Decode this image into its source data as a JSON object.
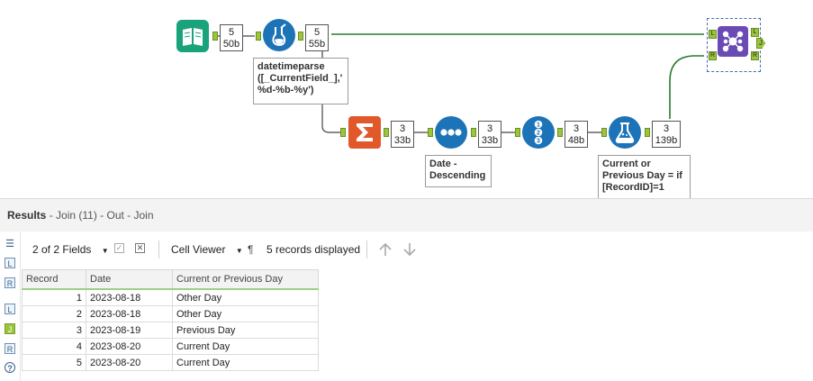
{
  "workflow": {
    "counts": [
      {
        "records": "5",
        "size": "50b"
      },
      {
        "records": "5",
        "size": "55b"
      },
      {
        "records": "3",
        "size": "33b"
      },
      {
        "records": "3",
        "size": "33b"
      },
      {
        "records": "3",
        "size": "48b"
      },
      {
        "records": "3",
        "size": "139b"
      }
    ],
    "annotations": {
      "formula": "datetimeparse\n([_CurrentField_],'\n%d-%b-%y')",
      "sort": "Date -\nDescending",
      "formula2": "Current or\nPrevious Day = if\n[RecordID]=1"
    },
    "join_anchors": {
      "left": "L",
      "right": "R",
      "join": "J",
      "out_left": "L",
      "out_right": "R"
    },
    "colors": {
      "input": "#1aa37a",
      "formula": "#1c73b7",
      "summarize": "#e1582b",
      "join": "#6a4bb6",
      "wire": "#2b7a2b"
    }
  },
  "results": {
    "title_label": "Results",
    "title_rest": " - Join (11) - Out - Join",
    "fields_label": "2 of 2 Fields",
    "viewer_label": "Cell Viewer",
    "records_label": "5 records displayed",
    "pilcrow": "¶",
    "side_tags": [
      "L",
      "R",
      "L",
      "J",
      "R",
      "?"
    ],
    "columns": [
      "Record",
      "Date",
      "Current or Previous Day"
    ],
    "rows": [
      {
        "record": "1",
        "date": "2023-08-18",
        "day": "Other Day"
      },
      {
        "record": "2",
        "date": "2023-08-18",
        "day": "Other Day"
      },
      {
        "record": "3",
        "date": "2023-08-19",
        "day": "Previous Day"
      },
      {
        "record": "4",
        "date": "2023-08-20",
        "day": "Current Day"
      },
      {
        "record": "5",
        "date": "2023-08-20",
        "day": "Current Day"
      }
    ]
  }
}
